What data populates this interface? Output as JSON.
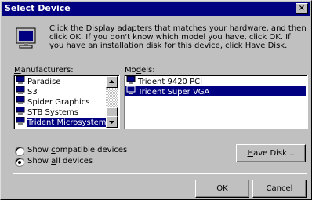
{
  "window": {
    "title": "Select Device",
    "close_glyph": "×"
  },
  "icon": {
    "name": "monitor-icon"
  },
  "instructions": "Click the Display adapters that matches your hardware, and then click OK. If you don't know which model you have, click OK. If you have an installation disk for this device, click Have Disk.",
  "manufacturers": {
    "label_prefix": "M",
    "label_rest": "anufacturers:",
    "items": [
      {
        "label": "Paradise"
      },
      {
        "label": "S3"
      },
      {
        "label": "Spider Graphics"
      },
      {
        "label": "STB Systems"
      },
      {
        "label": "Trident Microsystems",
        "selected": true
      }
    ]
  },
  "models": {
    "label_prefix": "Mo",
    "label_mnemonic": "d",
    "label_rest": "els:",
    "items": [
      {
        "label": "Trident 9420 PCI"
      },
      {
        "label": "Trident Super VGA",
        "selected": true
      }
    ]
  },
  "radios": {
    "compatible": {
      "prefix": "Show ",
      "mnemonic": "c",
      "rest": "ompatible devices",
      "checked": false
    },
    "all": {
      "prefix": "Show ",
      "mnemonic": "a",
      "rest": "ll devices",
      "checked": true
    }
  },
  "buttons": {
    "have_disk": {
      "mnemonic": "H",
      "rest": "ave Disk..."
    },
    "ok": "OK",
    "cancel": "Cancel"
  },
  "colors": {
    "titlebar": "#000080",
    "face": "#c0c0c0",
    "selection": "#000080"
  }
}
